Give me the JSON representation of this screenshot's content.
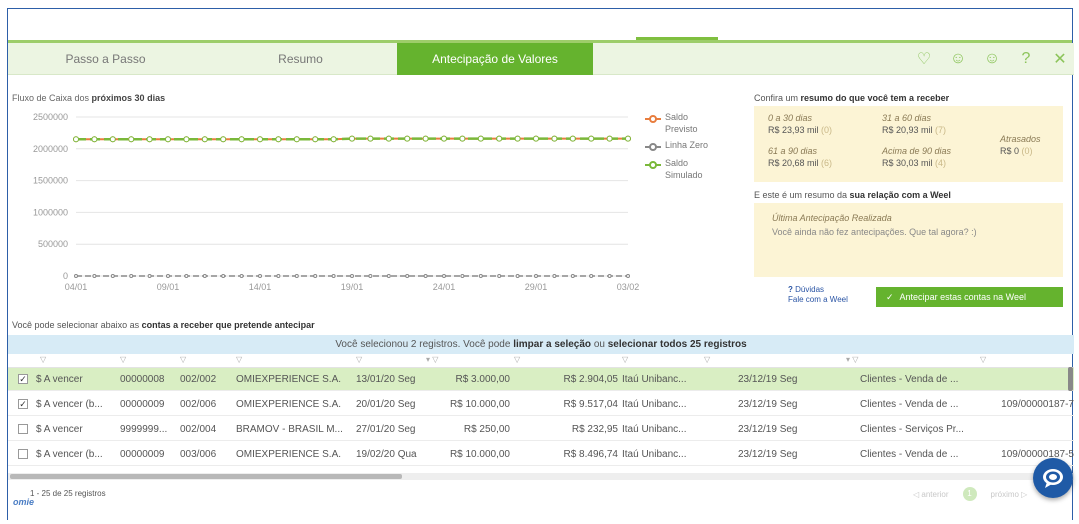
{
  "tabs": [
    {
      "label": "Passo a Passo",
      "active": false
    },
    {
      "label": "Resumo",
      "active": false
    },
    {
      "label": "Antecipação de Valores",
      "active": true
    }
  ],
  "tab_icons": [
    "heart-icon",
    "smile-icon",
    "neutral-face-icon",
    "help-icon",
    "close-icon"
  ],
  "chart_title": {
    "prefix": "Fluxo de Caixa dos ",
    "bold": "próximos 30 dias"
  },
  "chart_data": {
    "type": "line",
    "x_tick_labels": [
      "04/01",
      "09/01",
      "14/01",
      "19/01",
      "24/01",
      "29/01",
      "03/02"
    ],
    "y_tick_labels": [
      "2500000",
      "2000000",
      "1500000",
      "1000000",
      "500000",
      "0"
    ],
    "ylim": [
      0,
      2500000
    ],
    "series": [
      {
        "name": "Saldo Previsto",
        "color": "#e87d3e",
        "values": [
          2150000,
          2150000,
          2150000,
          2150000,
          2150000,
          2150000,
          2150000,
          2150000,
          2150000,
          2150000,
          2150000,
          2150000,
          2150000,
          2150000,
          2150000,
          2160000,
          2160000,
          2160000,
          2160000,
          2160000,
          2160000,
          2160000,
          2160000,
          2160000,
          2160000,
          2160000,
          2160000,
          2160000,
          2160000,
          2160000,
          2160000
        ]
      },
      {
        "name": "Linha Zero",
        "color": "#888888",
        "values": [
          0,
          0,
          0,
          0,
          0,
          0,
          0,
          0,
          0,
          0,
          0,
          0,
          0,
          0,
          0,
          0,
          0,
          0,
          0,
          0,
          0,
          0,
          0,
          0,
          0,
          0,
          0,
          0,
          0,
          0,
          0
        ]
      },
      {
        "name": "Saldo Simulado",
        "color": "#7ab83a",
        "values": [
          2150000,
          2150000,
          2150000,
          2150000,
          2150000,
          2150000,
          2150000,
          2150000,
          2150000,
          2150000,
          2150000,
          2150000,
          2150000,
          2150000,
          2150000,
          2160000,
          2160000,
          2160000,
          2160000,
          2160000,
          2160000,
          2160000,
          2160000,
          2160000,
          2160000,
          2160000,
          2160000,
          2160000,
          2160000,
          2160000,
          2160000
        ]
      }
    ],
    "grid": true,
    "legend": "right"
  },
  "legend": {
    "previsto": [
      "Saldo",
      "Previsto"
    ],
    "zero": [
      "Linha Zero"
    ],
    "simulado": [
      "Saldo",
      "Simulado"
    ]
  },
  "summary": {
    "title_prefix": "Confira um ",
    "title_bold": "resumo do que você tem a receber",
    "cells": [
      {
        "label": "0 a 30 dias",
        "value": "R$ 23,93 mil",
        "count": "(0)"
      },
      {
        "label": "31 a 60 dias",
        "value": "R$ 20,93 mil",
        "count": "(7)"
      },
      {
        "label": "61 a 90 dias",
        "value": "R$ 20,68 mil",
        "count": "(6)"
      },
      {
        "label": "Acima de 90 dias",
        "value": "R$ 30,03 mil",
        "count": "(4)"
      },
      {
        "label": "Atrasados",
        "value": "R$ 0",
        "count": "(0)"
      }
    ]
  },
  "relation": {
    "title_prefix": "E este é um resumo da ",
    "title_bold": "sua relação com a Weel",
    "label": "Última Antecipação Realizada",
    "text": "Você ainda não fez antecipações. Que tal agora? :)"
  },
  "help": {
    "q": "Dúvidas",
    "contact": "Fale com a Weel"
  },
  "antecipar_button": "Antecipar estas contas na Weel",
  "select_note": {
    "prefix": "Você pode selecionar abaixo as ",
    "bold": "contas a receber que pretende antecipar"
  },
  "banner": {
    "p1": "Você selecionou 2 registros. Você pode ",
    "link1": "limpar a seleção",
    "p2": " ou ",
    "link2": "selecionar todos 25 registros"
  },
  "rows": [
    {
      "checked": true,
      "selected": true,
      "status": "$ A vencer",
      "doc": "00000008",
      "parc": "002/002",
      "client": "OMIEXPERIENCE S.A.",
      "due": "13/01/20 Seg",
      "value": "R$ 3.000,00",
      "net": "R$ 2.904,05",
      "bank": "Itaú Unibanc...",
      "date2": "23/12/19 Seg",
      "category": "Clientes - Venda de ...",
      "extra": ""
    },
    {
      "checked": true,
      "selected": false,
      "status": "$ A vencer (b...",
      "doc": "00000009",
      "parc": "002/006",
      "client": "OMIEXPERIENCE S.A.",
      "due": "20/01/20 Seg",
      "value": "R$ 10.000,00",
      "net": "R$ 9.517,04",
      "bank": "Itaú Unibanc...",
      "date2": "23/12/19 Seg",
      "category": "Clientes - Venda de ...",
      "extra": "109/00000187-7"
    },
    {
      "checked": false,
      "selected": false,
      "status": "$ A vencer",
      "doc": "9999999...",
      "parc": "002/004",
      "client": "BRAMOV - BRASIL M...",
      "due": "27/01/20 Seg",
      "value": "R$ 250,00",
      "net": "R$ 232,95",
      "bank": "Itaú Unibanc...",
      "date2": "23/12/19 Seg",
      "category": "Clientes - Serviços Pr...",
      "extra": ""
    },
    {
      "checked": false,
      "selected": false,
      "status": "$ A vencer (b...",
      "doc": "00000009",
      "parc": "003/006",
      "client": "OMIEXPERIENCE S.A.",
      "due": "19/02/20 Qua",
      "value": "R$ 10.000,00",
      "net": "R$ 8.496,74",
      "bank": "Itaú Unibanc...",
      "date2": "23/12/19 Seg",
      "category": "Clientes - Venda de ...",
      "extra": "109/00000187-5"
    }
  ],
  "footer": {
    "count": "1 - 25 de 25 registros",
    "logo": "omie",
    "prev": "anterior",
    "page": "1",
    "next": "próximo"
  }
}
